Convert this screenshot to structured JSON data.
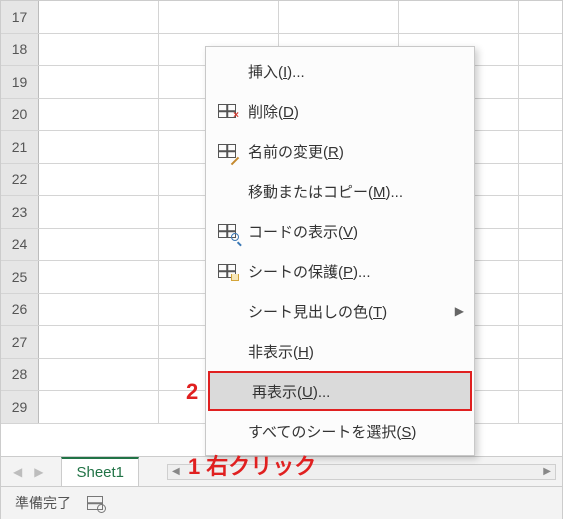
{
  "rows": [
    "17",
    "18",
    "19",
    "20",
    "21",
    "22",
    "23",
    "24",
    "25",
    "26",
    "27",
    "28",
    "29"
  ],
  "sheet_tab": "Sheet1",
  "statusbar": {
    "ready": "準備完了"
  },
  "context_menu": {
    "insert": {
      "label": "挿入",
      "accel": "I",
      "suffix": "..."
    },
    "delete": {
      "label": "削除",
      "accel": "D",
      "suffix": ""
    },
    "rename": {
      "label": "名前の変更",
      "accel": "R",
      "suffix": ""
    },
    "move_copy": {
      "label": "移動またはコピー",
      "accel": "M",
      "suffix": "..."
    },
    "view_code": {
      "label": "コードの表示",
      "accel": "V",
      "suffix": ""
    },
    "protect": {
      "label": "シートの保護",
      "accel": "P",
      "suffix": "..."
    },
    "tab_color": {
      "label": "シート見出しの色",
      "accel": "T",
      "suffix": ""
    },
    "hide": {
      "label": "非表示",
      "accel": "H",
      "suffix": ""
    },
    "unhide": {
      "label": "再表示",
      "accel": "U",
      "suffix": "..."
    },
    "select_all": {
      "label": "すべてのシートを選択",
      "accel": "S",
      "suffix": ""
    }
  },
  "annotations": {
    "step1_num": "1",
    "step1_text": "右クリック",
    "step2_num": "2"
  }
}
